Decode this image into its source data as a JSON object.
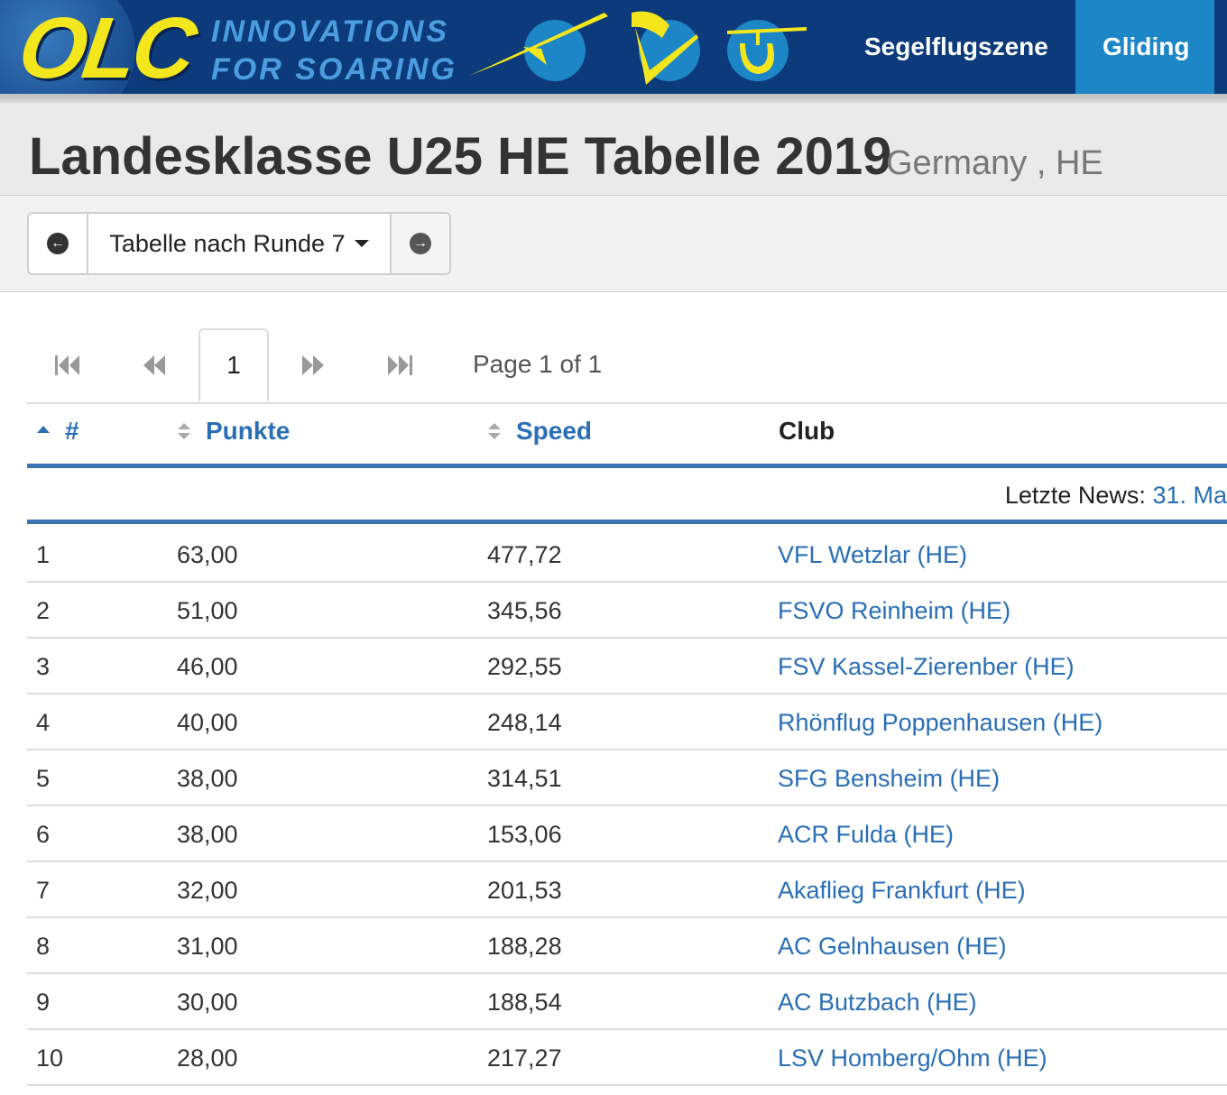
{
  "topbar": {
    "logo": "OLC",
    "tagline_1": "INNOVATIONS",
    "tagline_2": "FOR SOARING",
    "nav": {
      "scene": "Segelflugszene",
      "gliding": "Gliding"
    },
    "colors": {
      "bg": "#0c3a7a",
      "logo": "#f4e61c",
      "active_tab": "#1c86c6"
    },
    "icons": [
      "glider-icon",
      "paraglider-icon",
      "hangglider-icon"
    ]
  },
  "header": {
    "title": "Landesklasse U25 HE Tabelle 2019",
    "subtitle": "Germany , HE"
  },
  "toolbar": {
    "round_select": "Tabelle nach Runde 7"
  },
  "pager": {
    "current": "1",
    "info": "Page 1 of 1"
  },
  "table": {
    "headers": {
      "rank": "#",
      "points": "Punkte",
      "speed": "Speed",
      "club": "Club"
    },
    "news_label": "Letzte News:",
    "news_link": "31. Ma",
    "rows": [
      {
        "rank": "1",
        "points": "63,00",
        "speed": "477,72",
        "club": "VFL Wetzlar (HE)"
      },
      {
        "rank": "2",
        "points": "51,00",
        "speed": "345,56",
        "club": "FSVO Reinheim (HE)"
      },
      {
        "rank": "3",
        "points": "46,00",
        "speed": "292,55",
        "club": "FSV Kassel-Zierenber (HE)"
      },
      {
        "rank": "4",
        "points": "40,00",
        "speed": "248,14",
        "club": "Rhönflug Poppenhausen (HE)"
      },
      {
        "rank": "5",
        "points": "38,00",
        "speed": "314,51",
        "club": "SFG Bensheim (HE)"
      },
      {
        "rank": "6",
        "points": "38,00",
        "speed": "153,06",
        "club": "ACR Fulda (HE)"
      },
      {
        "rank": "7",
        "points": "32,00",
        "speed": "201,53",
        "club": "Akaflieg Frankfurt (HE)"
      },
      {
        "rank": "8",
        "points": "31,00",
        "speed": "188,28",
        "club": "AC Gelnhausen (HE)"
      },
      {
        "rank": "9",
        "points": "30,00",
        "speed": "188,54",
        "club": "AC Butzbach (HE)"
      },
      {
        "rank": "10",
        "points": "28,00",
        "speed": "217,27",
        "club": "LSV Homberg/Ohm (HE)"
      }
    ]
  }
}
